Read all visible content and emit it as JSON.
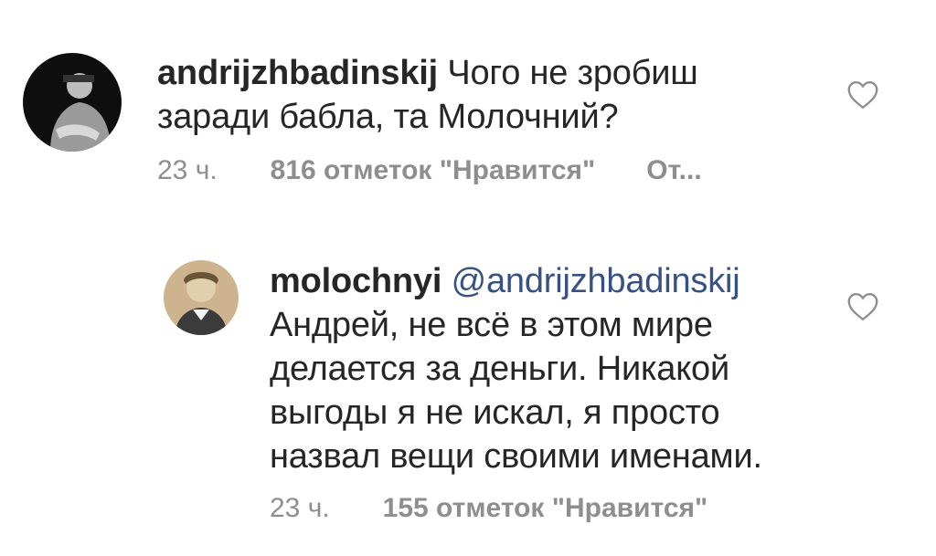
{
  "comments": [
    {
      "username": "andrijzhbadinskij",
      "text_line1": "Чого не зробиш",
      "text_line2": "заради бабла, та Молочний?",
      "time": "23 ч.",
      "likes": "816 отметок \"Нравится\"",
      "reply": "От...",
      "avatar_icon": "user-avatar-dark",
      "like_icon": "heart-outline-icon"
    },
    {
      "username": "molochnyi",
      "mention": "@andrijzhbadinskij",
      "text_line1": "Андрей, не всё в этом мире",
      "text_line2": "делается за деньги. Никакой",
      "text_line3": "выгоды я не искал, я просто",
      "text_line4": "назвал вещи своими именами.",
      "time": "23 ч.",
      "likes": "155 отметок \"Нравится\"",
      "avatar_icon": "user-avatar-sepia",
      "like_icon": "heart-outline-icon"
    }
  ],
  "colors": {
    "text": "#262626",
    "meta": "#8e8e8e",
    "mention": "#385185",
    "background": "#ffffff"
  }
}
